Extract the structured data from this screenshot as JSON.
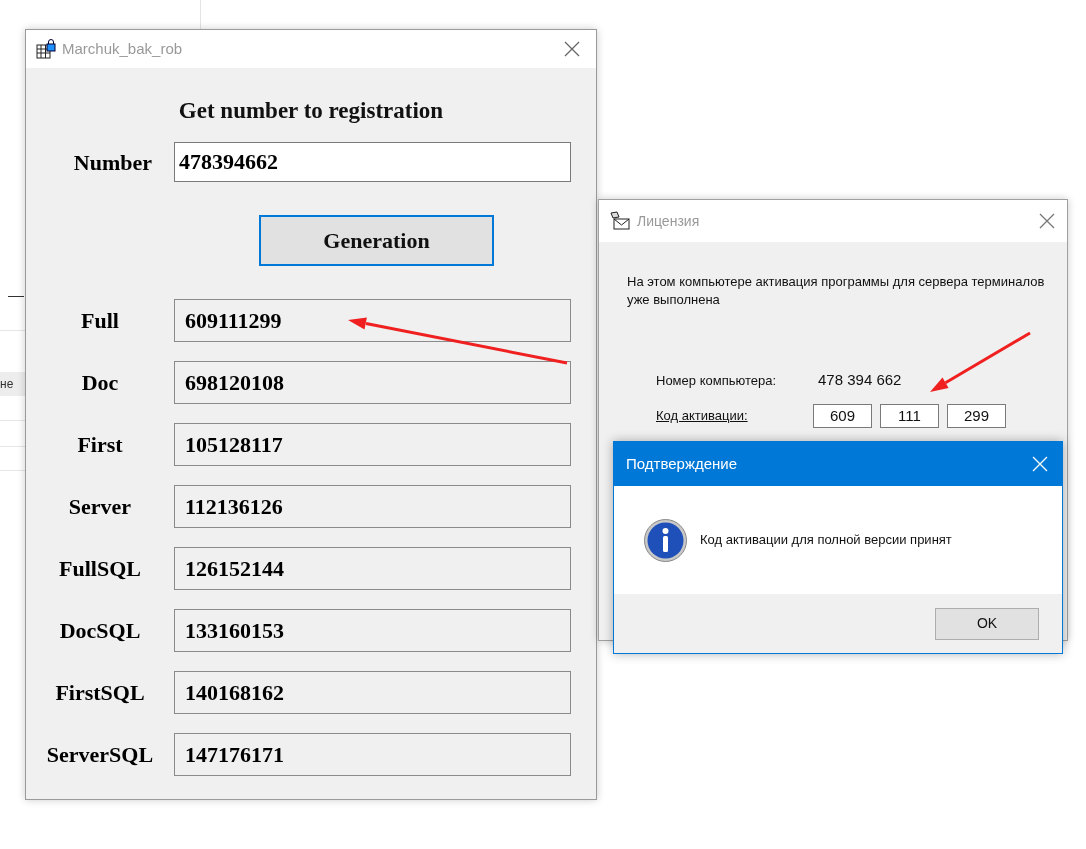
{
  "background_app": {
    "fragment": "не"
  },
  "main_window": {
    "title": "Marchuk_bak_rob",
    "heading": "Get number to registration",
    "number": {
      "label": "Number",
      "value": "478394662"
    },
    "generate_button": "Generation",
    "codes": [
      {
        "label": "Full",
        "value": "609111299"
      },
      {
        "label": "Doc",
        "value": "698120108"
      },
      {
        "label": "First",
        "value": "105128117"
      },
      {
        "label": "Server",
        "value": "112136126"
      },
      {
        "label": "FullSQL",
        "value": "126152144"
      },
      {
        "label": "DocSQL",
        "value": "133160153"
      },
      {
        "label": "FirstSQL",
        "value": "140168162"
      },
      {
        "label": "ServerSQL",
        "value": "147176171"
      }
    ]
  },
  "license_window": {
    "title": "Лицензия",
    "message": "На этом компьютере активация программы для сервера терминалов уже выполнена",
    "computer_number": {
      "label": "Номер компьютера:",
      "value": "478 394 662"
    },
    "activation_code": {
      "label": "Код активации:",
      "parts": [
        "609",
        "111",
        "299"
      ]
    }
  },
  "confirm_dialog": {
    "title": "Подтверждение",
    "message": "Код активации для полной версии принят",
    "ok_button": "OK"
  }
}
